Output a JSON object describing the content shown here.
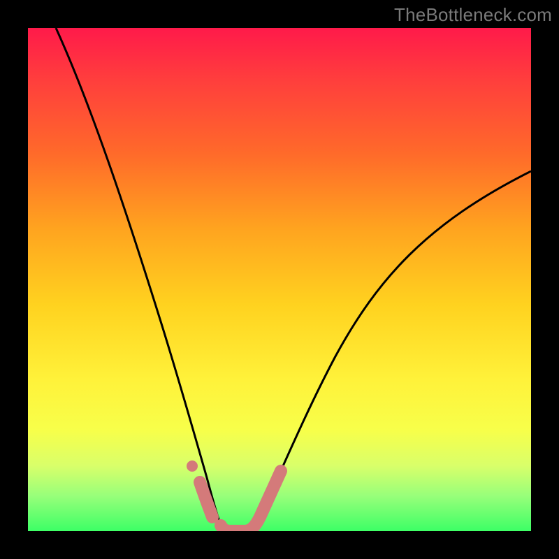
{
  "watermark": "TheBottleneck.com",
  "chart_data": {
    "type": "line",
    "title": "",
    "xlabel": "",
    "ylabel": "",
    "xlim": [
      0,
      100
    ],
    "ylim": [
      0,
      100
    ],
    "x": [
      0,
      4,
      8,
      12,
      16,
      20,
      24,
      27,
      30,
      32,
      34,
      36,
      38,
      40,
      42,
      44,
      48,
      52,
      56,
      60,
      65,
      70,
      75,
      80,
      85,
      90,
      95,
      100
    ],
    "y": [
      100,
      89,
      78,
      68,
      58,
      48,
      38,
      28,
      18,
      10,
      4,
      0,
      0,
      0,
      0,
      4,
      14,
      24,
      33,
      41,
      49,
      55,
      60,
      64,
      67,
      69,
      70.5,
      71.5
    ],
    "minimum_region": {
      "x_start": 32,
      "x_end": 44,
      "x_center": 38
    },
    "annotations": [
      {
        "type": "marker_segment",
        "x_start": 32,
        "x_end": 34,
        "y_start": 10,
        "y_end": 4,
        "color": "#d47a7a"
      },
      {
        "type": "dot",
        "x": 31,
        "y": 13,
        "color": "#d47a7a"
      },
      {
        "type": "marker_segment_flat",
        "x_start": 36,
        "x_end": 44,
        "y": 0,
        "color": "#d47a7a"
      }
    ],
    "gradient_stops": [
      {
        "pos": 0.0,
        "color": "#ff1a4a"
      },
      {
        "pos": 0.1,
        "color": "#ff3d3d"
      },
      {
        "pos": 0.25,
        "color": "#ff6a2a"
      },
      {
        "pos": 0.4,
        "color": "#ffa41f"
      },
      {
        "pos": 0.55,
        "color": "#ffd21f"
      },
      {
        "pos": 0.7,
        "color": "#fff23a"
      },
      {
        "pos": 0.8,
        "color": "#f7ff4a"
      },
      {
        "pos": 0.87,
        "color": "#d9ff6a"
      },
      {
        "pos": 0.93,
        "color": "#98ff7a"
      },
      {
        "pos": 1.0,
        "color": "#3dff66"
      }
    ],
    "colors": {
      "curve": "#000000",
      "marker": "#d47a7a",
      "frame": "#000000"
    }
  }
}
